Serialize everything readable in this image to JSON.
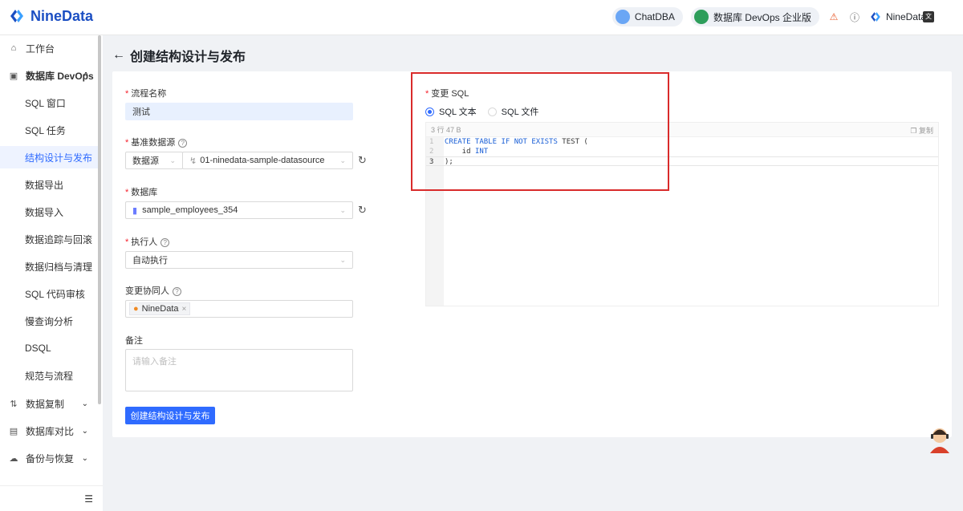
{
  "header": {
    "brand": "NineData",
    "chatdba": "ChatDBA",
    "edition": "数据库 DevOps 企业版",
    "user": "NineData"
  },
  "sidebar": {
    "items": [
      {
        "label": "工作台",
        "icon": "home-icon"
      },
      {
        "label": "数据库 DevOps",
        "icon": "devops-icon",
        "expanded": true
      },
      {
        "label": "SQL 窗口"
      },
      {
        "label": "SQL 任务"
      },
      {
        "label": "结构设计与发布",
        "active": true
      },
      {
        "label": "数据导出"
      },
      {
        "label": "数据导入"
      },
      {
        "label": "数据追踪与回滚"
      },
      {
        "label": "数据归档与清理"
      },
      {
        "label": "SQL 代码审核"
      },
      {
        "label": "慢查询分析"
      },
      {
        "label": "DSQL"
      },
      {
        "label": "规范与流程"
      },
      {
        "label": "数据复制",
        "icon": "replication-icon"
      },
      {
        "label": "数据库对比",
        "icon": "compare-icon"
      },
      {
        "label": "备份与恢复",
        "icon": "backup-icon"
      }
    ]
  },
  "page": {
    "title": "创建结构设计与发布",
    "form": {
      "flow_name_label": "流程名称",
      "flow_name_value": "测试",
      "datasource_label": "基准数据源",
      "datasource_type": "数据源",
      "datasource_value": "01-ninedata-sample-datasource",
      "database_label": "数据库",
      "database_value": "sample_employees_354",
      "executor_label": "执行人",
      "executor_value": "自动执行",
      "collaborator_label": "变更协同人",
      "collaborator_tag": "NineData",
      "remark_label": "备注",
      "remark_placeholder": "请输入备注",
      "submit_label": "创建结构设计与发布"
    },
    "sql": {
      "label": "变更 SQL",
      "option_text": "SQL 文本",
      "option_file": "SQL 文件",
      "selected": "SQL 文本",
      "meta": "3 行  47 B",
      "copy_label": "复制",
      "lines": [
        {
          "num": "1",
          "code": "CREATE TABLE IF NOT EXISTS TEST ("
        },
        {
          "num": "2",
          "code": "    id INT"
        },
        {
          "num": "3",
          "code": ");"
        }
      ]
    }
  },
  "colors": {
    "primary": "#2f6bff",
    "highlight_box": "#d92b2b",
    "brand": "#1c4fc3"
  }
}
